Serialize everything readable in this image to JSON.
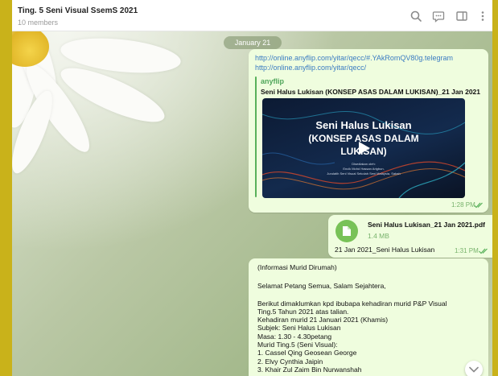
{
  "header": {
    "title": "Ting. 5 Seni Visual SsemS 2021",
    "subtitle": "10 members",
    "icons": [
      "search-icon",
      "chat-icon",
      "sidebar-icon",
      "more-icon"
    ]
  },
  "date_separator": "January 21",
  "messages": [
    {
      "type": "link",
      "urls": [
        "http://online.anyflip.com/yitar/qecc/#.YAkRomQV80g.telegram",
        "http://online.anyflip.com/yitar/qecc/"
      ],
      "preview_site": "anyflip",
      "preview_title": "Seni Halus Lukisan (KONSEP ASAS DALAM LUKISAN)_21 Jan 2021",
      "thumb_title_1": "Seni Halus Lukisan",
      "thumb_title_2": "(KONSEP ASAS DALAM",
      "thumb_title_3": "LUKISAN)",
      "thumb_small_1": "Disediakan oleh:",
      "thumb_small_2": "Encik Mohd Hassan Arigbun,",
      "thumb_small_3": "Jurulatih Seni Visual Sekolah Seni Malaysia, Sabah",
      "time": "1:28 PM"
    },
    {
      "type": "file",
      "file_name": "Seni Halus Lukisan_21 Jan 2021.pdf",
      "file_size": "1.4 MB",
      "caption": "21 Jan 2021_Seni Halus Lukisan",
      "time": "1:31 PM"
    },
    {
      "type": "text",
      "lines": [
        "(Informasi Murid Dirumah)",
        "",
        "Selamat Petang Semua, Salam Sejahtera,",
        "",
        "Berikut dimaklumkan kpd ibubapa kehadiran murid P&P Visual",
        "Ting.5 Tahun 2021 atas talian.",
        "Kehadiran murid 21 Januari 2021 (Khamis)",
        "Subjek: Seni Halus Lukisan",
        "Masa: 1.30 - 4.30petang",
        "Murid Ting.5 (Seni Visual):",
        "1. Cassel Qing Geosean George",
        "2. Elvy Cynthia Jaipin",
        "3. Khair Zul Zaim Bin Nurwanshah"
      ]
    }
  ]
}
